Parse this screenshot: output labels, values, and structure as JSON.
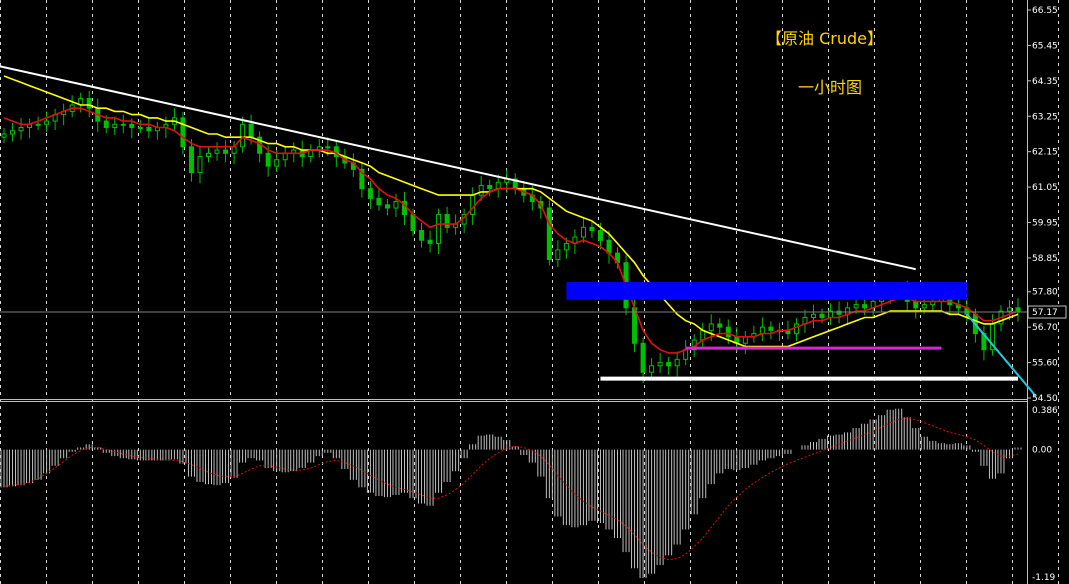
{
  "title": "【原油 Crude】",
  "subtitle": "一小时图",
  "colors": {
    "background": "#000000",
    "grid": "#ffffff",
    "bull_candle": "#00c000",
    "bear_candle": "#00c000",
    "ma_fast": "#e01010",
    "ma_slow": "#ffff00",
    "trendline": "#ffffff",
    "resistance_zone": "#0000ff",
    "support_magenta": "#e020e0",
    "support_white": "#ffffff",
    "projection": "#1ecbe1",
    "histogram": "#c0c0c0",
    "signal": "#e01010"
  },
  "chart_data": [
    {
      "type": "candlestick",
      "timeframe_label": "一小时图",
      "ylim": [
        54.5,
        66.55
      ],
      "yticks": [
        "66.55",
        "65.45",
        "64.35",
        "63.25",
        "62.15",
        "61.05",
        "59.95",
        "58.85",
        "57.80",
        "56.70",
        "55.60",
        "54.50"
      ],
      "current_price": "57.17",
      "grid": true,
      "series": [
        {
          "name": "close",
          "values": [
            62.7,
            62.8,
            62.9,
            63.0,
            63.0,
            63.1,
            63.3,
            63.4,
            63.6,
            63.8,
            63.5,
            63.1,
            62.9,
            63.0,
            63.0,
            62.9,
            62.9,
            62.8,
            62.9,
            63.0,
            63.2,
            62.3,
            61.5,
            62.0,
            62.1,
            62.2,
            62.1,
            62.3,
            63.0,
            62.6,
            62.1,
            61.7,
            61.9,
            62.1,
            62.2,
            62.0,
            62.2,
            62.3,
            62.3,
            62.0,
            61.8,
            61.6,
            61.0,
            60.7,
            60.5,
            60.4,
            60.6,
            60.2,
            59.7,
            59.4,
            59.3,
            60.2,
            59.8,
            59.9,
            60.2,
            60.8,
            61.1,
            61.0,
            61.2,
            61.3,
            61.0,
            60.8,
            60.6,
            60.4,
            58.8,
            59.1,
            59.3,
            59.5,
            59.8,
            59.7,
            59.4,
            59.0,
            58.7,
            57.3,
            56.2,
            55.3,
            55.5,
            55.6,
            55.5,
            55.7,
            56.0,
            56.3,
            56.6,
            56.8,
            56.7,
            56.4,
            56.2,
            56.4,
            56.5,
            56.7,
            56.6,
            56.6,
            56.5,
            56.8,
            57.0,
            57.1,
            57.0,
            57.2,
            57.1,
            57.3,
            57.4,
            57.3,
            57.5,
            57.6,
            57.8,
            57.9,
            57.5,
            57.3,
            57.4,
            57.5,
            57.6,
            57.4,
            57.3,
            57.1,
            56.5,
            56.0,
            56.8,
            57.2,
            57.3,
            57.2
          ]
        },
        {
          "name": "MA-red",
          "values": [
            63.2,
            63.1,
            63.0,
            63.0,
            63.1,
            63.2,
            63.3,
            63.4,
            63.5,
            63.5,
            63.4,
            63.3,
            63.2,
            63.2,
            63.1,
            63.1,
            63.0,
            63.0,
            62.9,
            62.9,
            62.8,
            62.6,
            62.4,
            62.3,
            62.3,
            62.3,
            62.3,
            62.3,
            62.6,
            62.5,
            62.4,
            62.2,
            62.1,
            62.1,
            62.1,
            62.1,
            62.2,
            62.2,
            62.2,
            62.1,
            61.9,
            61.8,
            61.5,
            61.3,
            61.0,
            60.8,
            60.7,
            60.5,
            60.2,
            60.0,
            59.8,
            59.9,
            59.9,
            59.9,
            60.1,
            60.4,
            60.7,
            60.9,
            61.0,
            61.0,
            61.0,
            60.9,
            60.8,
            60.5,
            59.9,
            59.6,
            59.4,
            59.3,
            59.4,
            59.3,
            59.2,
            59.0,
            58.7,
            58.0,
            57.3,
            56.6,
            56.2,
            56.0,
            55.9,
            55.9,
            56.0,
            56.1,
            56.3,
            56.4,
            56.5,
            56.5,
            56.4,
            56.4,
            56.4,
            56.5,
            56.5,
            56.6,
            56.6,
            56.7,
            56.8,
            56.9,
            56.9,
            57.0,
            57.0,
            57.1,
            57.2,
            57.2,
            57.3,
            57.4,
            57.5,
            57.6,
            57.6,
            57.5,
            57.5,
            57.5,
            57.5,
            57.5,
            57.4,
            57.3,
            57.1,
            56.9,
            56.9,
            57.0,
            57.1,
            57.2
          ]
        },
        {
          "name": "MA-yellow",
          "values": [
            64.5,
            64.4,
            64.3,
            64.2,
            64.1,
            64.0,
            63.9,
            63.8,
            63.7,
            63.6,
            63.6,
            63.5,
            63.5,
            63.4,
            63.4,
            63.3,
            63.3,
            63.2,
            63.2,
            63.1,
            63.1,
            63.0,
            62.9,
            62.8,
            62.7,
            62.7,
            62.6,
            62.6,
            62.6,
            62.6,
            62.5,
            62.4,
            62.4,
            62.3,
            62.3,
            62.2,
            62.2,
            62.2,
            62.1,
            62.1,
            62.0,
            61.9,
            61.8,
            61.7,
            61.5,
            61.4,
            61.3,
            61.2,
            61.1,
            61.0,
            60.9,
            60.8,
            60.8,
            60.8,
            60.8,
            60.8,
            60.9,
            60.9,
            61.0,
            61.0,
            61.0,
            61.0,
            61.0,
            60.9,
            60.7,
            60.5,
            60.3,
            60.2,
            60.1,
            60.0,
            59.8,
            59.6,
            59.3,
            59.0,
            58.7,
            58.3,
            58.0,
            57.7,
            57.4,
            57.1,
            56.9,
            56.8,
            56.6,
            56.5,
            56.4,
            56.3,
            56.2,
            56.1,
            56.1,
            56.1,
            56.1,
            56.1,
            56.1,
            56.2,
            56.3,
            56.4,
            56.5,
            56.6,
            56.7,
            56.8,
            56.9,
            57.0,
            57.0,
            57.1,
            57.2,
            57.2,
            57.2,
            57.2,
            57.2,
            57.2,
            57.2,
            57.1,
            57.1,
            57.0,
            56.9,
            56.8,
            56.8,
            56.9,
            57.0,
            57.1
          ]
        }
      ],
      "annotations": {
        "trendline": {
          "from": [
            0,
            64.8
          ],
          "to": [
            107,
            58.5
          ]
        },
        "resistance_zone": {
          "x_from": 66,
          "x_to": 113,
          "y_from": 57.55,
          "y_to": 58.1
        },
        "support_magenta": {
          "x_from": 80,
          "x_to": 110,
          "y": 56.05
        },
        "support_white": {
          "x_from": 70,
          "x_to": 119,
          "y": 55.1
        },
        "projection": {
          "from": [
            113,
            57.1
          ],
          "to": [
            119,
            54.55
          ]
        }
      }
    },
    {
      "type": "bar",
      "subplot": "MACD",
      "ylim": [
        -1.19,
        0.386
      ],
      "yticks": [
        "0.386",
        "0.00",
        "-1.19"
      ],
      "series": [
        {
          "name": "histogram",
          "values": [
            -0.35,
            -0.34,
            -0.33,
            -0.31,
            -0.28,
            -0.22,
            -0.15,
            -0.08,
            -0.02,
            0.02,
            0.05,
            0.02,
            -0.03,
            -0.06,
            -0.08,
            -0.09,
            -0.1,
            -0.1,
            -0.1,
            -0.1,
            -0.09,
            -0.13,
            -0.25,
            -0.3,
            -0.32,
            -0.33,
            -0.31,
            -0.26,
            -0.12,
            -0.08,
            -0.1,
            -0.17,
            -0.2,
            -0.21,
            -0.2,
            -0.17,
            -0.12,
            -0.06,
            -0.03,
            -0.08,
            -0.18,
            -0.28,
            -0.35,
            -0.4,
            -0.43,
            -0.44,
            -0.42,
            -0.4,
            -0.45,
            -0.5,
            -0.52,
            -0.4,
            -0.3,
            -0.2,
            -0.08,
            0.05,
            0.13,
            0.14,
            0.12,
            0.09,
            0.03,
            -0.05,
            -0.12,
            -0.25,
            -0.45,
            -0.62,
            -0.7,
            -0.72,
            -0.7,
            -0.66,
            -0.68,
            -0.74,
            -0.82,
            -0.95,
            -1.1,
            -1.19,
            -1.15,
            -1.07,
            -0.98,
            -0.88,
            -0.74,
            -0.6,
            -0.45,
            -0.32,
            -0.22,
            -0.18,
            -0.19,
            -0.17,
            -0.14,
            -0.1,
            -0.08,
            -0.06,
            -0.04,
            0.0,
            0.04,
            0.07,
            0.1,
            0.13,
            0.14,
            0.16,
            0.2,
            0.24,
            0.28,
            0.32,
            0.37,
            0.38,
            0.3,
            0.2,
            0.12,
            0.08,
            0.06,
            0.05,
            0.06,
            0.04,
            -0.02,
            -0.15,
            -0.27,
            -0.22,
            -0.08,
            0.02
          ]
        },
        {
          "name": "signal",
          "values": [
            -0.34,
            -0.33,
            -0.32,
            -0.3,
            -0.27,
            -0.22,
            -0.17,
            -0.11,
            -0.05,
            -0.01,
            0.02,
            0.02,
            0.0,
            -0.02,
            -0.04,
            -0.06,
            -0.07,
            -0.08,
            -0.09,
            -0.09,
            -0.1,
            -0.11,
            -0.14,
            -0.17,
            -0.21,
            -0.24,
            -0.25,
            -0.25,
            -0.22,
            -0.18,
            -0.15,
            -0.15,
            -0.16,
            -0.18,
            -0.19,
            -0.19,
            -0.17,
            -0.14,
            -0.11,
            -0.1,
            -0.12,
            -0.15,
            -0.19,
            -0.24,
            -0.28,
            -0.32,
            -0.35,
            -0.37,
            -0.39,
            -0.42,
            -0.45,
            -0.45,
            -0.42,
            -0.37,
            -0.31,
            -0.23,
            -0.15,
            -0.08,
            -0.03,
            0.01,
            0.03,
            0.02,
            -0.01,
            -0.06,
            -0.14,
            -0.24,
            -0.33,
            -0.41,
            -0.48,
            -0.53,
            -0.57,
            -0.61,
            -0.65,
            -0.71,
            -0.79,
            -0.88,
            -0.95,
            -1.0,
            -1.02,
            -1.01,
            -0.97,
            -0.9,
            -0.82,
            -0.72,
            -0.62,
            -0.52,
            -0.44,
            -0.37,
            -0.31,
            -0.26,
            -0.21,
            -0.17,
            -0.13,
            -0.1,
            -0.07,
            -0.04,
            -0.01,
            0.02,
            0.05,
            0.08,
            0.11,
            0.14,
            0.17,
            0.21,
            0.25,
            0.28,
            0.29,
            0.28,
            0.25,
            0.22,
            0.19,
            0.16,
            0.14,
            0.12,
            0.09,
            0.04,
            -0.02,
            -0.06,
            -0.06,
            -0.04
          ]
        }
      ]
    }
  ]
}
